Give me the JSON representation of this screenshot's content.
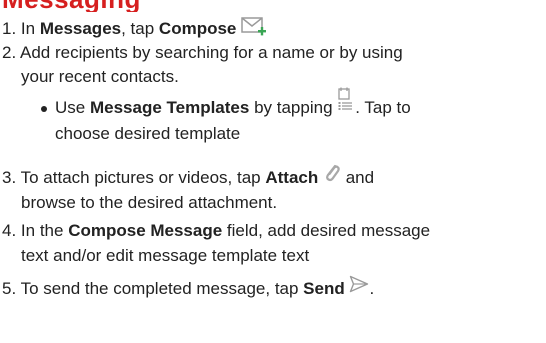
{
  "heading": "Messaging",
  "steps": [
    {
      "number": "1.",
      "pre": "In ",
      "bold1": "Messages",
      "mid": ", tap ",
      "bold2": "Compose",
      "icon": "compose-icon"
    },
    {
      "number": "2.",
      "line1": "Add recipients by searching for a name or by using",
      "line2": "your recent contacts."
    },
    {
      "bullet_pre": "Use ",
      "bullet_bold": "Message Templates",
      "bullet_mid": " by tapping ",
      "bullet_post": ".  Tap to",
      "bullet_line2": "choose desired template",
      "icon": "templates-icon"
    },
    {
      "number": "3.",
      "pre": "To attach pictures or videos, tap ",
      "bold": "Attach",
      "post": " and",
      "line2": "browse to the desired attachment.",
      "icon": "paperclip-icon"
    },
    {
      "number": "4.",
      "pre": "In the ",
      "bold": "Compose Message",
      "post": " field, add desired message",
      "line2": "text and/or edit message  template text"
    },
    {
      "number": "5.",
      "pre": "To send the completed message, tap ",
      "bold": "Send",
      "post": ".",
      "icon": "send-icon"
    }
  ],
  "colors": {
    "heading": "#d61f1f",
    "text": "#222222",
    "icon_gray": "#9a9a9a",
    "icon_green": "#3aa655"
  }
}
